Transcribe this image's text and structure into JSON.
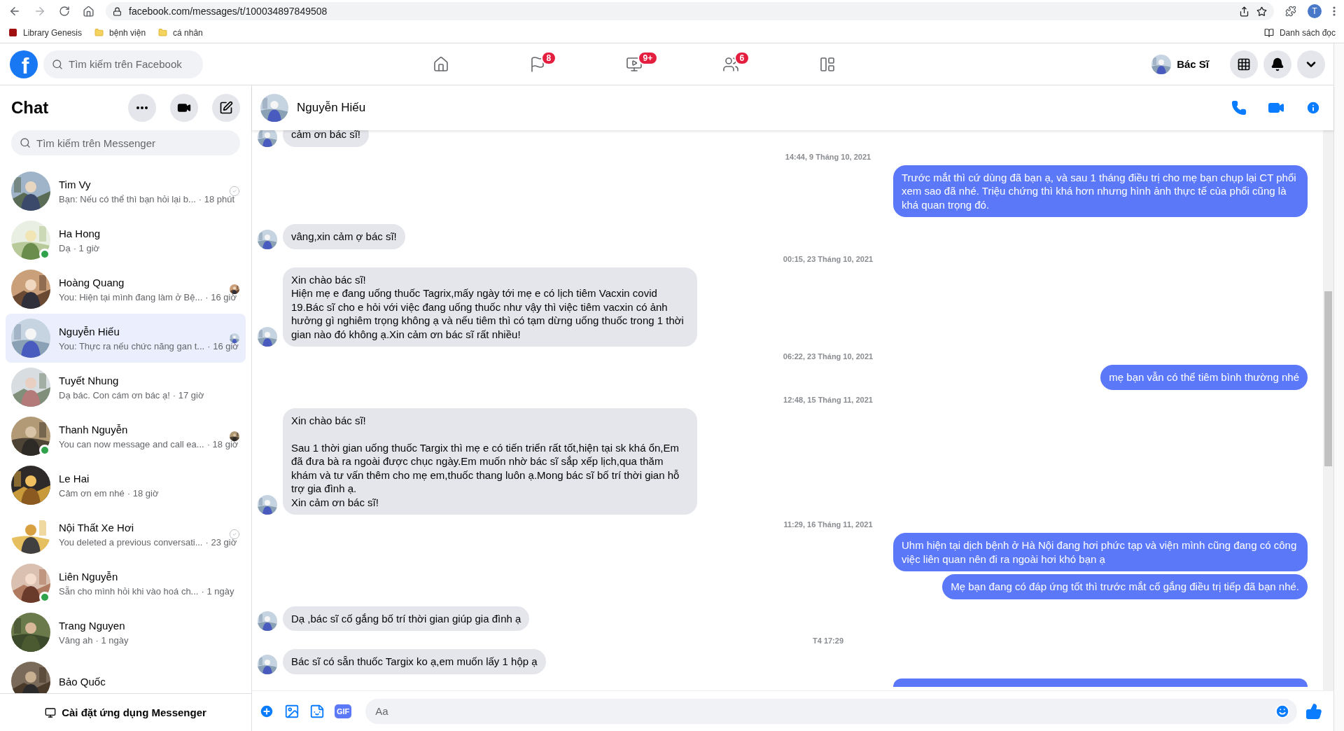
{
  "browser": {
    "url": "facebook.com/messages/t/100034897849508",
    "profile_initial": "T",
    "bookmarks": [
      {
        "label": "Library Genesis",
        "kind": "site"
      },
      {
        "label": "bệnh viện",
        "kind": "folder"
      },
      {
        "label": "cá nhân",
        "kind": "folder"
      }
    ],
    "reading_list": "Danh sách đọc"
  },
  "topbar": {
    "logo": "f",
    "search_placeholder": "Tìm kiếm trên Facebook",
    "nav": [
      {
        "selected": false
      },
      {
        "badge": "8",
        "selected": false
      },
      {
        "badge": "9+",
        "selected": false
      },
      {
        "badge": "6",
        "selected": false
      },
      {
        "selected": false
      }
    ],
    "profile_name": "Bác Sĩ"
  },
  "sidebar": {
    "title": "Chat",
    "search_placeholder": "Tìm kiếm trên Messenger",
    "conversations": [
      {
        "name": "Tim Vy",
        "preview": "Bạn: Nếu có thể thì bạn hỏi lại b...",
        "time": "· 18 phút",
        "online": false,
        "delivered": true,
        "seen": false,
        "selected": false
      },
      {
        "name": "Ha Hong",
        "preview": "Dạ",
        "time": "· 1 giờ",
        "online": true,
        "delivered": false,
        "seen": false,
        "selected": false
      },
      {
        "name": "Hoàng Quang",
        "preview": "You: Hiện tại mình đang làm ở Bệ...",
        "time": "· 16 giờ",
        "online": false,
        "delivered": false,
        "seen": true,
        "selected": false
      },
      {
        "name": "Nguyễn Hiếu",
        "preview": "You: Thực ra nếu chức năng gan t...",
        "time": "· 16 giờ",
        "online": false,
        "delivered": false,
        "seen": true,
        "selected": true
      },
      {
        "name": "Tuyết Nhung",
        "preview": "Dạ bác. Con cám ơn bác ạ!",
        "time": "· 17 giờ",
        "online": false,
        "delivered": false,
        "seen": false,
        "selected": false
      },
      {
        "name": "Thanh Nguyễn",
        "preview": "You can now message and call ea...",
        "time": "· 18 giờ",
        "online": true,
        "delivered": false,
        "seen": true,
        "selected": false
      },
      {
        "name": "Le Hai",
        "preview": "Cảm ơn em nhé",
        "time": "· 18 giờ",
        "online": false,
        "delivered": false,
        "seen": false,
        "selected": false
      },
      {
        "name": "Nội Thất Xe Hơi",
        "preview": "You deleted a previous conversati...",
        "time": "· 23 giờ",
        "online": false,
        "delivered": true,
        "seen": false,
        "selected": false
      },
      {
        "name": "Liên Nguyễn",
        "preview": "Sẵn cho mình hỏi khi vào hoá ch...",
        "time": "· 1 ngày",
        "online": true,
        "delivered": false,
        "seen": false,
        "selected": false
      },
      {
        "name": "Trang Nguyen",
        "preview": "Vâng ah",
        "time": "· 1 ngày",
        "online": false,
        "delivered": false,
        "seen": false,
        "selected": false
      },
      {
        "name": "Bảo Quốc",
        "online": false,
        "delivered": false,
        "seen": false,
        "selected": false
      }
    ],
    "install_label": "Cài đặt ứng dụng Messenger"
  },
  "chat": {
    "name": "Nguyễn Hiếu",
    "messages": [
      {
        "kind": "incoming",
        "text": "cảm ơn bác sĩ!"
      },
      {
        "kind": "timestamp",
        "text": "14:44, 9 Tháng 10, 2021"
      },
      {
        "kind": "outgoing",
        "text": "Trước mắt thì cứ dùng đã bạn ạ, và sau 1 tháng điều trị cho mẹ bạn chụp lại CT phổi xem sao đã nhé. Triệu chứng thì khá hơn nhưng hình ảnh thực tế của phổi cũng là khá quan trọng đó."
      },
      {
        "kind": "incoming",
        "text": "vâng,xin cảm ợ bác sĩ!"
      },
      {
        "kind": "timestamp",
        "text": "00:15, 23 Tháng 10, 2021"
      },
      {
        "kind": "incoming",
        "text": "Xin chào bác sĩ!\nHiện mẹ e đang uống thuốc Tagrix,mấy ngày tới mẹ e có lịch tiêm Vacxin covid 19.Bác sĩ cho e hỏi với việc đang uống thuốc như vậy thì việc tiêm vacxin có ảnh hưởng gì nghiêm trọng không ạ và nếu tiêm thì có tạm dừng uống thuốc trong 1 thời gian nào đó không ạ.Xin cảm ơn bác sĩ rất nhiều!"
      },
      {
        "kind": "timestamp",
        "text": "06:22, 23 Tháng 10, 2021"
      },
      {
        "kind": "outgoing",
        "text": "mẹ bạn vẫn có thể tiêm bình thường nhé"
      },
      {
        "kind": "timestamp",
        "text": "12:48, 15 Tháng 11, 2021"
      },
      {
        "kind": "incoming",
        "text": "Xin chào bác sĩ!\n\nSau 1 thời gian uống thuốc Targix thì mẹ e có tiến triển rất tốt,hiện tại sk khá ổn,Em đã đưa bà ra ngoài được chục ngày.Em muốn nhờ bác sĩ sắp xếp lịch,qua thăm khám và tư vấn thêm cho mẹ em,thuốc thang luôn ạ.Mong bác sĩ bố trí thời gian hỗ trợ gia đình ạ.\nXin cảm ơn bác sĩ!"
      },
      {
        "kind": "timestamp",
        "text": "11:29, 16 Tháng 11, 2021"
      },
      {
        "kind": "outgoing",
        "text": "Uhm hiện tại dịch bệnh ở Hà Nội đang hơi phức tạp và viện mình cũng đang có công việc liên quan nên đi ra ngoài hơi khó bạn ạ"
      },
      {
        "kind": "outgoing",
        "text": "Mẹ bạn đang có đáp ứng tốt thì trước mắt cố gắng điều trị tiếp đã bạn nhé."
      },
      {
        "kind": "incoming",
        "text": "Dạ ,bác sĩ cố gắng bố trí thời gian giúp gia đình ạ"
      },
      {
        "kind": "timestamp",
        "text": "T4 17:29"
      },
      {
        "kind": "incoming",
        "text": "Bác sĩ có sẵn thuốc Targix ko ạ,em muốn lấy 1 hộp ạ"
      },
      {
        "kind": "outgoing"
      }
    ],
    "composer": {
      "placeholder": "Aa",
      "gif_label": "GIF"
    }
  }
}
